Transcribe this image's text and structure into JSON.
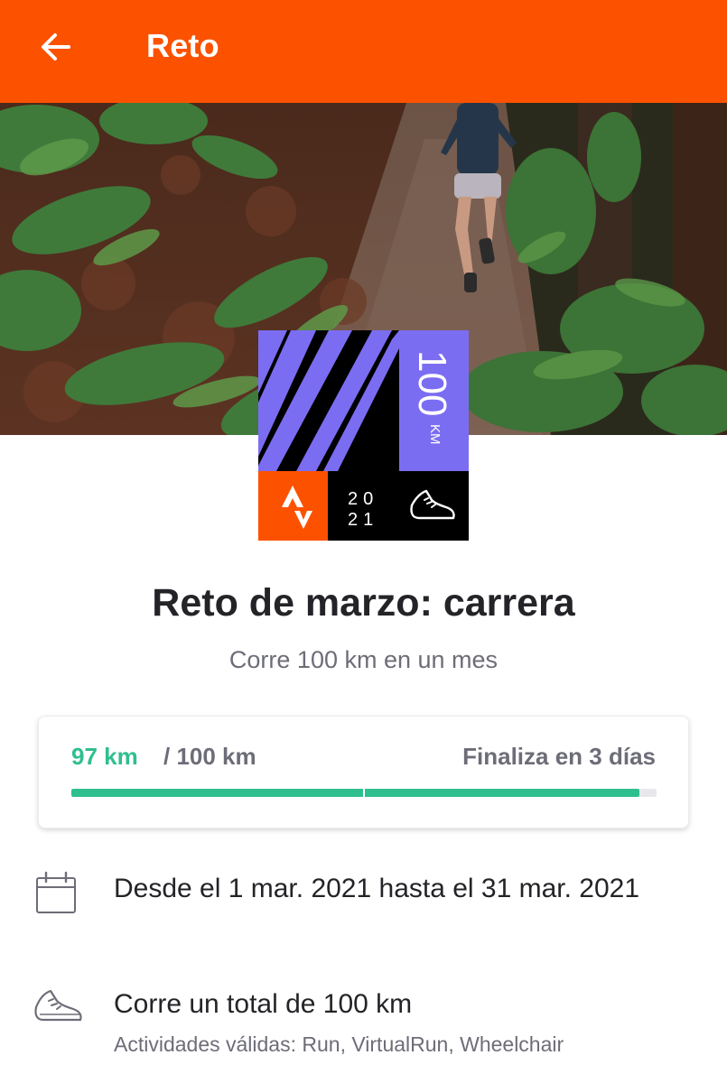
{
  "header": {
    "title": "Reto",
    "back_icon": "arrow-left-icon",
    "background": "#fc5200"
  },
  "badge": {
    "distance_value": "100",
    "distance_unit": "KM",
    "year_top": "20",
    "year_bottom": "21",
    "sport_icon": "running-shoe-icon",
    "logo_icon": "strava-logo-icon",
    "accent": "#7b6df2"
  },
  "challenge": {
    "title": "Reto de marzo: carrera",
    "subtitle": "Corre 100 km en un mes"
  },
  "progress": {
    "completed": "97 km",
    "goal": "/ 100 km",
    "ends": "Finaliza en 3 días",
    "fraction": 0.97,
    "color": "#2fbf8e"
  },
  "details": {
    "dates_icon": "calendar-icon",
    "dates": "Desde el 1 mar. 2021 hasta el 31 mar. 2021",
    "goal_icon": "running-shoe-icon",
    "goal_text": "Corre un total de 100 km",
    "valid_activities": "Actividades válidas: Run, VirtualRun, Wheelchair"
  }
}
